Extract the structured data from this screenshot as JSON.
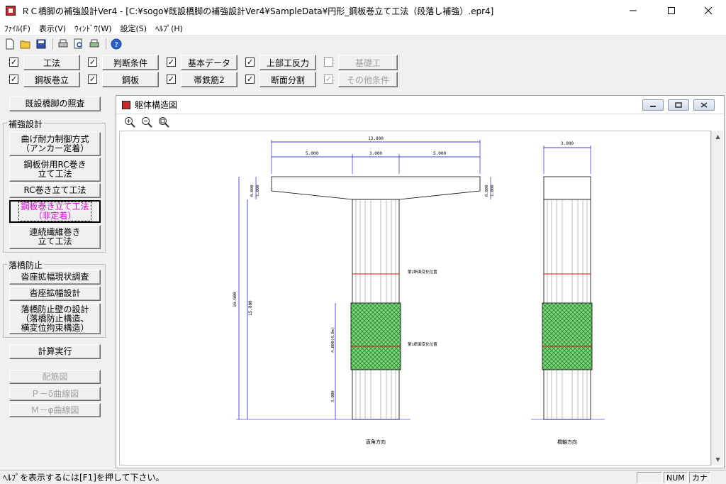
{
  "window": {
    "title": "ＲＣ橋脚の補強設計Ver4 - [C:¥sogo¥既設橋脚の補強設計Ver4¥SampleData¥円形_鋼板巻立て工法（段落し補強）.epr4]",
    "minimize": "—",
    "maximize": "☐",
    "close": "✕"
  },
  "menu": [
    "ﾌｧｲﾙ(F)",
    "表示(V)",
    "ｳｨﾝﾄﾞｳ(W)",
    "設定(S)",
    "ﾍﾙﾌﾟ(H)"
  ],
  "toolbar_icons": [
    "new-file-icon",
    "open-folder-icon",
    "save-icon",
    "print-icon",
    "print-preview-icon",
    "printer-setup-icon",
    "help-icon"
  ],
  "check_rows": [
    [
      {
        "label": "工法",
        "checked": true,
        "enabled": true
      },
      {
        "label": "判断条件",
        "checked": true,
        "enabled": true
      },
      {
        "label": "基本データ",
        "checked": true,
        "enabled": true
      },
      {
        "label": "上部工反力",
        "checked": true,
        "enabled": true
      },
      {
        "label": "基礎工",
        "checked": false,
        "enabled": false
      }
    ],
    [
      {
        "label": "鋼板巻立",
        "checked": true,
        "enabled": true
      },
      {
        "label": "鋼板",
        "checked": true,
        "enabled": true
      },
      {
        "label": "帯鉄筋2",
        "checked": true,
        "enabled": true
      },
      {
        "label": "断面分割",
        "checked": true,
        "enabled": true
      },
      {
        "label": "その他条件",
        "checked": true,
        "enabled": false
      }
    ]
  ],
  "left": {
    "check_existing": "既設橋脚の照査",
    "group_reinforce": "補強設計",
    "btn_bend": [
      "曲げ耐力制御方式",
      "（アンカー定着）"
    ],
    "btn_steel_rc": [
      "鋼板併用RC巻き",
      "立て工法"
    ],
    "btn_rc": [
      "RC巻き立て工法"
    ],
    "btn_steel": [
      "鋼板巻き立て工法",
      "（非定着）"
    ],
    "btn_fiber": [
      "連続繊維巻き",
      "立て工法"
    ],
    "group_fall": "落橋防止",
    "btn_survey": "沓座拡幅現状調査",
    "btn_seat": "沓座拡幅設計",
    "btn_wall": [
      "落橋防止壁の設計",
      "（落橋防止構造、",
      "横変位拘束構造）"
    ],
    "btn_calc": "計算実行",
    "btn_rebar": "配筋図",
    "btn_pd": "Ｐ－δ曲線図",
    "btn_mphi": "Ｍ－φ曲線図"
  },
  "child": {
    "title": "躯体構造図",
    "zoom_icons": [
      "zoom-in-icon",
      "zoom-out-icon",
      "zoom-fit-icon"
    ]
  },
  "drawing": {
    "dim_total_width": "13.000",
    "dim_left": "5.000",
    "dim_mid": "3.000",
    "dim_right": "5.000",
    "dim_side_width": "3.000",
    "dim_head_1": "0.800",
    "dim_head_2": "1.000",
    "dim_head_right_1": "0.800",
    "dim_head_right_2": "1.000",
    "dim_total_height": "16.600",
    "dim_column_height": "15.000",
    "dim_steel_height": "4.000(4.0m)",
    "dim_bottom": "3.000",
    "label_cut2": "第2断面変化位置",
    "label_cut1": "第1断面変化位置",
    "label_front": "直角方向",
    "label_side": "橋軸方向"
  },
  "status": {
    "message": "ﾍﾙﾌﾟを表示するには[F1]を押して下さい。",
    "num": "NUM",
    "kana": "カナ"
  }
}
